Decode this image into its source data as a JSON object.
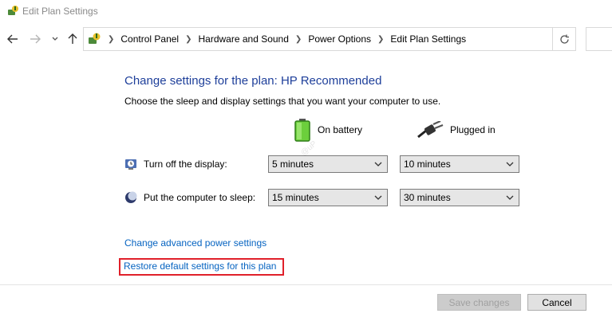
{
  "window": {
    "title": "Edit Plan Settings"
  },
  "nav": {
    "back_icon": "arrow-left-icon",
    "forward_icon": "arrow-right-icon",
    "recent_icon": "chevron-down-icon",
    "up_icon": "arrow-up-icon",
    "refresh_icon": "refresh-icon"
  },
  "breadcrumb": {
    "items": [
      "Control Panel",
      "Hardware and Sound",
      "Power Options",
      "Edit Plan Settings"
    ]
  },
  "main": {
    "heading": "Change settings for the plan: HP Recommended",
    "subheading": "Choose the sleep and display settings that you want your computer to use.",
    "col_battery": "On battery",
    "col_plugged": "Plugged in",
    "watermark": "@uP",
    "rows": {
      "display": {
        "label": "Turn off the display:",
        "battery_value": "5 minutes",
        "plugged_value": "10 minutes"
      },
      "sleep": {
        "label": "Put the computer to sleep:",
        "battery_value": "15 minutes",
        "plugged_value": "30 minutes"
      }
    },
    "links": {
      "advanced": "Change advanced power settings",
      "restore": "Restore default settings for this plan"
    }
  },
  "footer": {
    "save_label": "Save changes",
    "cancel_label": "Cancel"
  },
  "colors": {
    "heading": "#1e3f9a",
    "link": "#0563c1",
    "highlight_box": "#e0202a"
  }
}
